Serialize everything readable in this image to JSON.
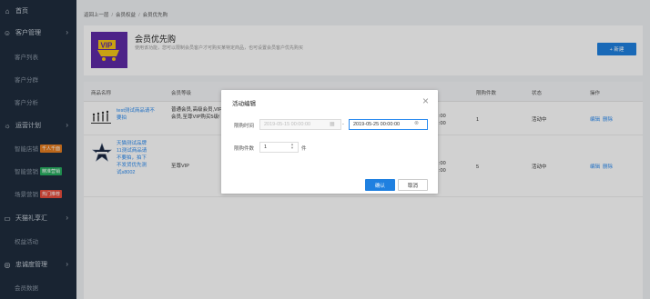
{
  "sidebar": {
    "items": [
      {
        "label": "首页",
        "icon": "home-icon"
      },
      {
        "label": "客户管理",
        "icon": "users-icon"
      },
      {
        "label": "客户列表"
      },
      {
        "label": "客户分群"
      },
      {
        "label": "客户分析"
      },
      {
        "label": "运营计划",
        "icon": "bulb-icon"
      },
      {
        "label": "智能店铺",
        "tag": "千人千面",
        "tag_color": "#e67e22"
      },
      {
        "label": "智能营销",
        "tag": "精准营销",
        "tag_color": "#27ae60"
      },
      {
        "label": "场景营销",
        "tag": "热门推荐",
        "tag_color": "#e74c3c"
      },
      {
        "label": "天猫礼享汇",
        "icon": "gift-icon"
      },
      {
        "label": "权益活动"
      },
      {
        "label": "忠诚度管理",
        "icon": "loyalty-icon"
      },
      {
        "label": "会员数据"
      }
    ]
  },
  "breadcrumb": [
    "返回上一层",
    "会员权益",
    "会员优先购"
  ],
  "header_card": {
    "vip_text": "VIP",
    "title": "会员优先购",
    "desc": "使用该功能，您可以限制会员客户才可购买某特定商品，也可设置会员客户优先购买",
    "new_button": "+ 新建"
  },
  "table": {
    "headers": [
      "商品名称",
      "会员等级",
      "限购件数",
      "状态",
      "操作"
    ],
    "rows": [
      {
        "name": "test测试商品请不要拍",
        "level": "普通会员,高级会员,VIP会员,至尊VIP购买5级!",
        "time": ":00\n:00",
        "qty": "1",
        "status": "活动中",
        "edit": "编辑",
        "delete": "删除"
      },
      {
        "name": "天猫测试品牌11测试商品请不要拍，拍下不发货优先测试s8002",
        "level": "至尊VIP",
        "time": ":00\n:00",
        "qty": "5",
        "status": "活动中",
        "edit": "编辑",
        "delete": "删除"
      }
    ]
  },
  "modal": {
    "title": "活动编辑",
    "time_label": "限购时间",
    "start_value": "2019-05-15 00:00:00",
    "dash": "-",
    "end_value": "2019-05-25 00:00:00",
    "count_label": "限购件数",
    "count_value": "1",
    "count_unit": "件",
    "confirm": "确认",
    "cancel": "取消"
  },
  "colors": {
    "sidebar": "#1f2d3d",
    "accent": "#1f80e0",
    "link": "#2d8cf0"
  }
}
